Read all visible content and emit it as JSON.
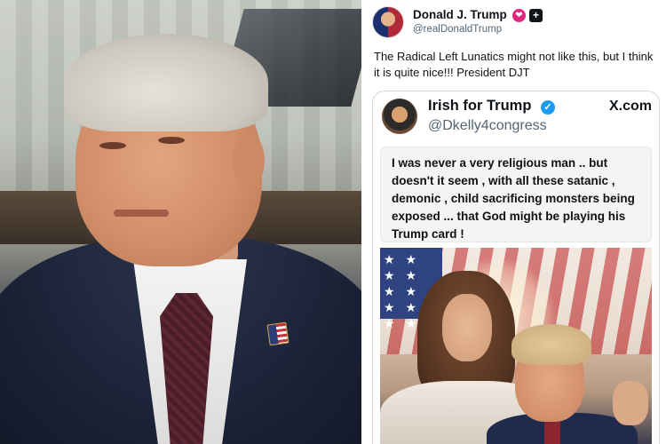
{
  "post": {
    "author_name": "Donald J. Trump",
    "author_handle": "@realDonaldTrump",
    "badge_icon": "heart-badge-icon",
    "plus_icon": "plus-square-icon",
    "text": "The Radical Left Lunatics might not like this, but I think it is quite nice!!! President DJT"
  },
  "quoted": {
    "author_name": "Irish for Trump",
    "author_handle": "@Dkelly4congress",
    "verified_icon": "verified-check-icon",
    "site": "X.com",
    "card_text": "I was never a very religious man .. but doesn't it seem , with all these satanic , demonic , child sacrificing monsters being exposed ... that God might be playing his Trump card !",
    "check_glyph": "✓"
  },
  "glyphs": {
    "badge": "❤",
    "plus": "+",
    "stars": "★ ★ ★ ★ ★ ★ ★ ★ ★ ★"
  },
  "colors": {
    "badge": "#e0267d",
    "verified": "#1d9bf0",
    "text": "#0f1419",
    "muted": "#536471"
  }
}
